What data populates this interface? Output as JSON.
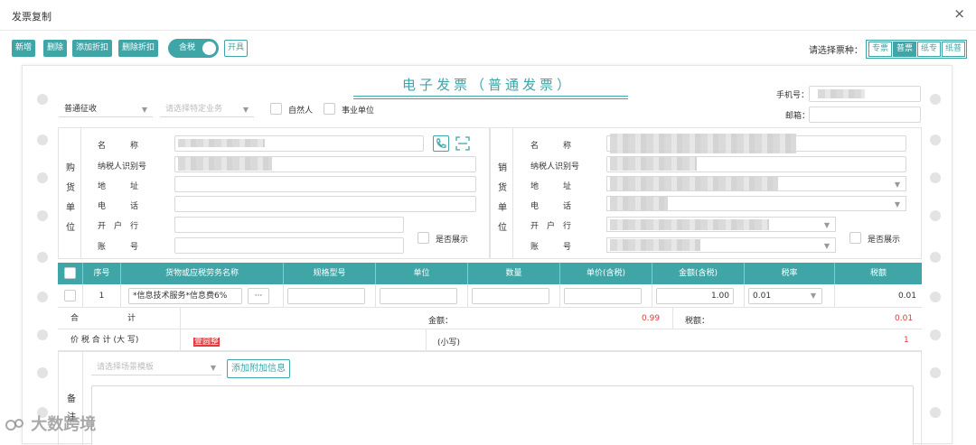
{
  "window": {
    "title": "发票复制",
    "close_icon": "×"
  },
  "toolbar": {
    "buttons": [
      "新增",
      "删除",
      "添加折扣",
      "删除折扣"
    ],
    "tax_toggle_label": "含税",
    "issue_button": "开具",
    "type_label": "请选择票种：",
    "type_options": [
      "专票",
      "普票",
      "纸专",
      "纸普"
    ],
    "selected_type": "普票"
  },
  "invoice": {
    "title": "电子发票（普通发票）",
    "tax_mode": "普通征收",
    "business_placeholder": "请选择特定业务",
    "natural_person_label": "自然人",
    "public_unit_label": "事业单位",
    "phone_label": "手机号：",
    "email_label": "邮箱：",
    "buyer": {
      "side_label": [
        "购",
        "货",
        "单",
        "位"
      ],
      "fields": [
        "名　　　称",
        "纳税人识别号",
        "地　　　址",
        "电　　　话",
        "开　户　行",
        "账　　　号"
      ],
      "show_label": "是否展示"
    },
    "seller": {
      "side_label": [
        "销",
        "货",
        "单",
        "位"
      ],
      "fields": [
        "名　　　称",
        "纳税人识别号",
        "地　　　址",
        "电　　　话",
        "开　户　行",
        "账　　　号"
      ],
      "show_label": "是否展示"
    },
    "table": {
      "headers": [
        "序号",
        "货物或应税劳务名称",
        "规格型号",
        "单位",
        "数量",
        "单价(含税)",
        "金额(含税)",
        "税率",
        "税额"
      ],
      "rows": [
        {
          "index": "1",
          "name": "*信息技术服务*信息费6%",
          "more": "···",
          "spec": "",
          "unit": "",
          "qty": "",
          "price": "",
          "amount": "1.00",
          "rate": "0.01",
          "tax": "0.01"
        }
      ]
    },
    "totals": {
      "label": "合　　　　　　计",
      "amount_label": "金额：",
      "amount": "0.99",
      "tax_label": "税额：",
      "tax": "0.01"
    },
    "grand_total": {
      "label": "价 税 合 计 (大 写)",
      "upper_value": "壹圆整",
      "lower_label": "(小写)",
      "lower_value": "1"
    },
    "remark": {
      "template_placeholder": "请选择场景模板",
      "add_info_button": "添加附加信息",
      "side_label": [
        "备",
        "注"
      ]
    }
  },
  "watermark": "大数跨境"
}
